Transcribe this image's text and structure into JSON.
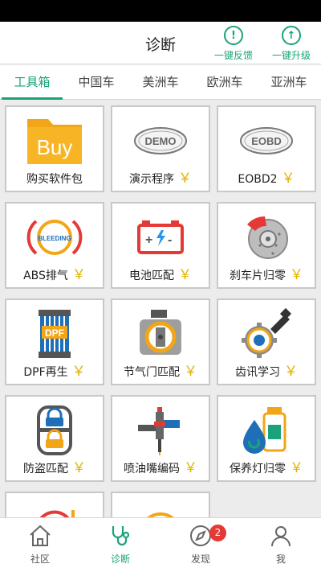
{
  "header": {
    "title": "诊断",
    "feedback_label": "一键反馈",
    "upgrade_label": "一键升级"
  },
  "tabs": [
    "工具箱",
    "中国车",
    "美洲车",
    "欧洲车",
    "亚洲车"
  ],
  "active_tab": "工具箱",
  "tools": [
    {
      "label": "购买软件包",
      "paid": false,
      "icon": "buy-folder-icon",
      "icon_text": "Buy"
    },
    {
      "label": "演示程序",
      "paid": true,
      "icon": "demo-badge-icon",
      "icon_text": "DEMO"
    },
    {
      "label": "EOBD2",
      "paid": true,
      "icon": "eobd-badge-icon",
      "icon_text": "EOBD"
    },
    {
      "label": "ABS排气",
      "paid": true,
      "icon": "brake-bleeding-icon",
      "icon_text": "BLEEDING"
    },
    {
      "label": "电池匹配",
      "paid": true,
      "icon": "battery-icon"
    },
    {
      "label": "刹车片归零",
      "paid": true,
      "icon": "brake-disc-icon"
    },
    {
      "label": "DPF再生",
      "paid": true,
      "icon": "dpf-filter-icon",
      "icon_text": "DPF"
    },
    {
      "label": "节气门匹配",
      "paid": true,
      "icon": "throttle-body-icon"
    },
    {
      "label": "齿讯学习",
      "paid": true,
      "icon": "gear-sensor-icon"
    },
    {
      "label": "防盗匹配",
      "paid": true,
      "icon": "immobilizer-icon"
    },
    {
      "label": "喷油嘴编码",
      "paid": true,
      "icon": "injector-icon"
    },
    {
      "label": "保养灯归零",
      "paid": true,
      "icon": "oil-service-icon"
    },
    {
      "label": "",
      "paid": false,
      "icon": "partial-red-gauge-icon"
    },
    {
      "label": "",
      "paid": false,
      "icon": "partial-reset-icon"
    }
  ],
  "price_symbol": "￥",
  "bottom_nav": [
    {
      "label": "社区",
      "icon": "home-icon",
      "active": false
    },
    {
      "label": "诊断",
      "icon": "stethoscope-icon",
      "active": true
    },
    {
      "label": "发现",
      "icon": "compass-icon",
      "active": false,
      "badge": "2"
    },
    {
      "label": "我",
      "icon": "person-icon",
      "active": false
    }
  ],
  "colors": {
    "accent": "#1aa37a",
    "price": "#e0b400",
    "badge": "#e53935"
  }
}
